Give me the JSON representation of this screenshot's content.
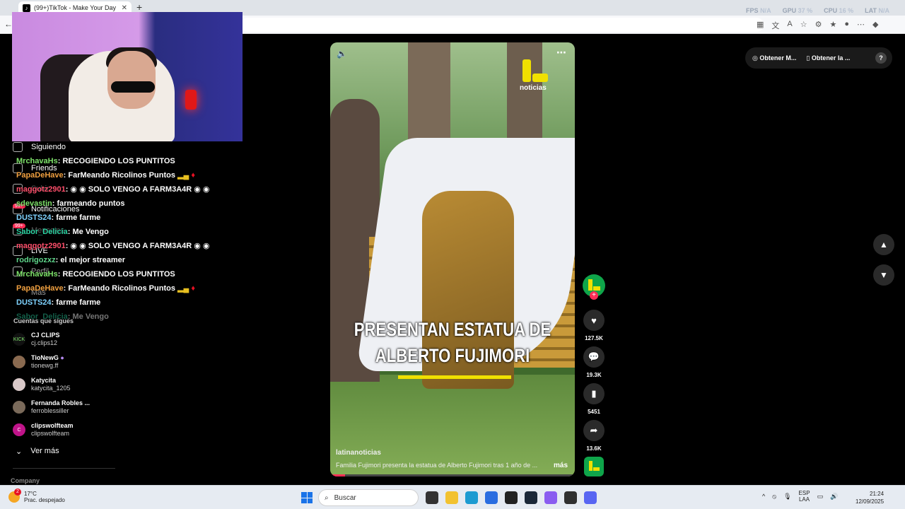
{
  "browser": {
    "tab_title": "(99+)TikTok - Make Your Day",
    "tab_icon": "tiktok-icon",
    "stats": [
      {
        "label": "FPS",
        "value": "N/A"
      },
      {
        "label": "GPU",
        "value": "37 %"
      },
      {
        "label": "CPU",
        "value": "16 %"
      },
      {
        "label": "LAT",
        "value": "N/A"
      }
    ]
  },
  "sidebar": {
    "nav": [
      {
        "label": "Siguiendo",
        "icon": "following-icon"
      },
      {
        "label": "Friends",
        "icon": "friends-icon"
      },
      {
        "label": "Subir",
        "icon": "upload-icon"
      },
      {
        "label": "Notificaciones",
        "icon": "bell-icon"
      },
      {
        "label": "Mensajes",
        "icon": "message-icon"
      },
      {
        "label": "LIVE",
        "icon": "live-icon"
      },
      {
        "label": "Perfil",
        "icon": "profile-icon"
      },
      {
        "label": "Más",
        "icon": "more-icon"
      }
    ],
    "badges": {
      "notifications": "99+",
      "messages": "99+"
    },
    "following_title": "Cuentas que sigues",
    "accounts": [
      {
        "name": "CJ CLIPS",
        "handle": "cj.clips12"
      },
      {
        "name": "TioNewG",
        "handle": "tionewg.ff"
      },
      {
        "name": "Katycita",
        "handle": "katycita_1205"
      },
      {
        "name": "Fernanda Robles ...",
        "handle": "ferroblessiller"
      },
      {
        "name": "clipswolfteam",
        "handle": "clipswolfteam"
      }
    ],
    "see_more": "Ver más",
    "company": "Company"
  },
  "chat": [
    {
      "user": "MrchavaHs",
      "msg": "RECOGIENDO LOS PUNTITOS",
      "color": "#7ee36a"
    },
    {
      "user": "PapaDeHave",
      "msg": "FarMeando Ricolinos Puntos",
      "color": "#f0a040"
    },
    {
      "user": "maggotz2901",
      "msg": "SOLO VENGO A FARM3A4R",
      "color": "#ff4f6b"
    },
    {
      "user": "sdevastin",
      "msg": "farmeando puntos",
      "color": "#7ee36a"
    },
    {
      "user": "DUSTS24",
      "msg": "farme farme",
      "color": "#7fd3ff"
    },
    {
      "user": "Sabor_Delicia",
      "msg": "Me Vengo",
      "color": "#2bd0a0"
    },
    {
      "user": "maggotz2901",
      "msg": "SOLO VENGO A FARM3A4R",
      "color": "#ff4f6b"
    },
    {
      "user": "rodrigozxz",
      "msg": "el mejor streamer",
      "color": "#5ed58a"
    },
    {
      "user": "MrchavaHs",
      "msg": "RECOGIENDO LOS PUNTITOS",
      "color": "#7ee36a"
    },
    {
      "user": "PapaDeHave",
      "msg": "FarMeando Ricolinos Puntos",
      "color": "#f0a040"
    },
    {
      "user": "DUSTS24",
      "msg": "farme farme",
      "color": "#7fd3ff"
    },
    {
      "user": "Sabor_Delicia",
      "msg": "Me Vengo",
      "color": "#2bd0a0"
    }
  ],
  "video": {
    "logo_text": "noticias",
    "headline_1": "PRESENTAN ESTATUA DE",
    "headline_2": "ALBERTO FUJIMORI",
    "author": "latinanoticias",
    "description": "Familia Fujimori presenta la estatua de Alberto Fujimori tras 1 año de ...",
    "more": "más",
    "progress": 0.06
  },
  "actions": {
    "likes": "127.5K",
    "comments": "19.3K",
    "saves": "5451",
    "shares": "13.6K"
  },
  "top_pill": {
    "item1": "Obtener M...",
    "item2": "Obtener la ..."
  },
  "taskbar": {
    "temp": "17°C",
    "weather": "Prac. despejado",
    "weather_badge": "2",
    "search": "Buscar",
    "lang": "ESP",
    "lang2": "LAA",
    "time": "21:24",
    "date": "12/09/2025"
  }
}
